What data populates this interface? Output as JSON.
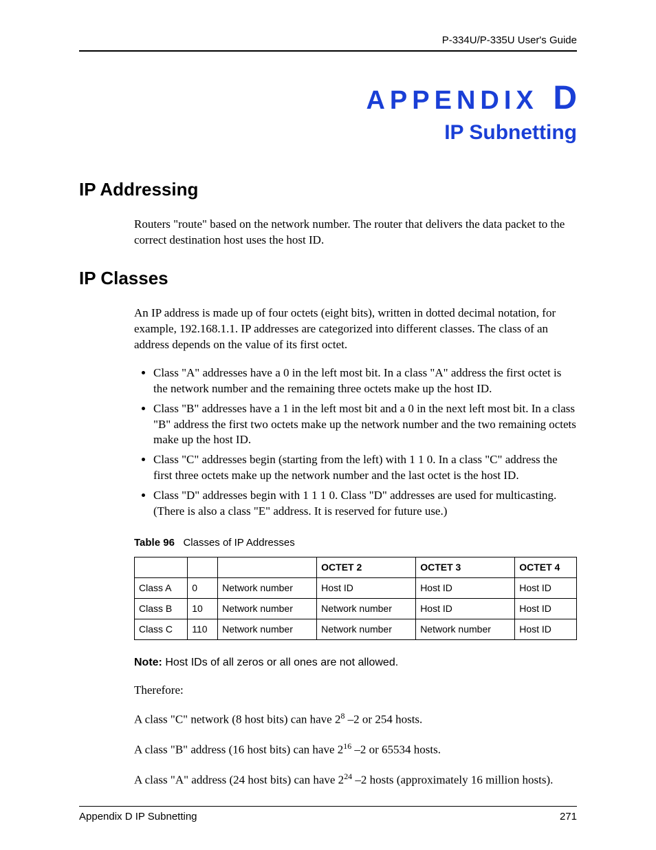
{
  "header": {
    "guide_name": "P-334U/P-335U User's Guide"
  },
  "appendix": {
    "label_prefix": "APPENDIX",
    "label_letter": "D",
    "subtitle": "IP Subnetting"
  },
  "sections": {
    "ip_addressing": {
      "heading": "IP Addressing",
      "para1": "Routers \"route\" based on the network number. The router that delivers the data packet to the correct destination host uses the host ID."
    },
    "ip_classes": {
      "heading": "IP Classes",
      "para1": "An IP address is made up of four octets (eight bits), written in dotted decimal notation, for example, 192.168.1.1. IP addresses are categorized into different classes. The class of an address depends on the value of its first octet.",
      "bullets": [
        "Class \"A\" addresses have a 0 in the left most bit. In a class \"A\" address the first octet is the network number and the remaining three octets make up the host ID.",
        "Class \"B\" addresses have a 1 in the left most bit and a 0 in the next left most bit. In a class \"B\" address the first two octets make up the network number and the two remaining octets make up the host ID.",
        "Class \"C\" addresses begin (starting from the left) with 1 1 0. In a class \"C\" address the first three octets make up the network number and the last octet is the host ID.",
        "Class \"D\" addresses begin with 1 1 1 0. Class \"D\" addresses are used for multicasting. (There is also a class \"E\" address. It is reserved for future use.)"
      ],
      "table": {
        "caption_num": "Table 96",
        "caption_title": "Classes of IP Addresses",
        "headers": [
          "",
          "",
          "",
          "OCTET 2",
          "OCTET 3",
          "OCTET 4"
        ],
        "rows": [
          [
            "Class A",
            "0",
            "Network number",
            "Host ID",
            "Host ID",
            "Host ID"
          ],
          [
            "Class B",
            "10",
            "Network number",
            "Network number",
            "Host ID",
            "Host ID"
          ],
          [
            "Class C",
            "110",
            "Network number",
            "Network number",
            "Network number",
            "Host ID"
          ]
        ]
      },
      "note_label": "Note:",
      "note_text": "Host IDs of all zeros or all ones are not allowed.",
      "therefore": "Therefore:",
      "calc_c_pre": "A class \"C\" network (8 host bits) can have 2",
      "calc_c_exp": "8",
      "calc_c_post": " –2 or 254 hosts.",
      "calc_b_pre": "A class \"B\" address (16 host bits) can have 2",
      "calc_b_exp": "16",
      "calc_b_post": " –2 or 65534 hosts.",
      "calc_a_pre": "A class \"A\" address (24 host bits) can have 2",
      "calc_a_exp": "24",
      "calc_a_post": " –2 hosts (approximately 16 million hosts)."
    }
  },
  "footer": {
    "left": "Appendix D IP Subnetting",
    "right": "271"
  }
}
